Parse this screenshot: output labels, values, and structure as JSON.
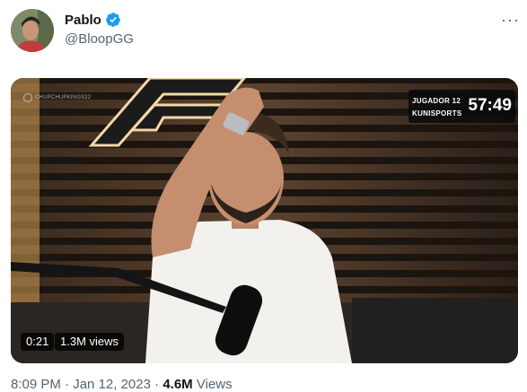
{
  "author": {
    "name": "Pablo",
    "handle": "@BloopGG",
    "verified_color": "#1d9bf0"
  },
  "menu": {
    "more_icon": "more-horizontal-icon"
  },
  "video": {
    "duration": "0:21",
    "views": "1.3M views",
    "watermark": "CHUPCHUPKINGS22",
    "scoreboard": {
      "team1": "JUGADOR 12",
      "team2": "KUNISPORTS",
      "clock": "57:49"
    }
  },
  "footer": {
    "time": "8:09 PM",
    "date": "Jan 12, 2023",
    "views": "4.6M",
    "views_label": "Views",
    "separator": "·"
  }
}
